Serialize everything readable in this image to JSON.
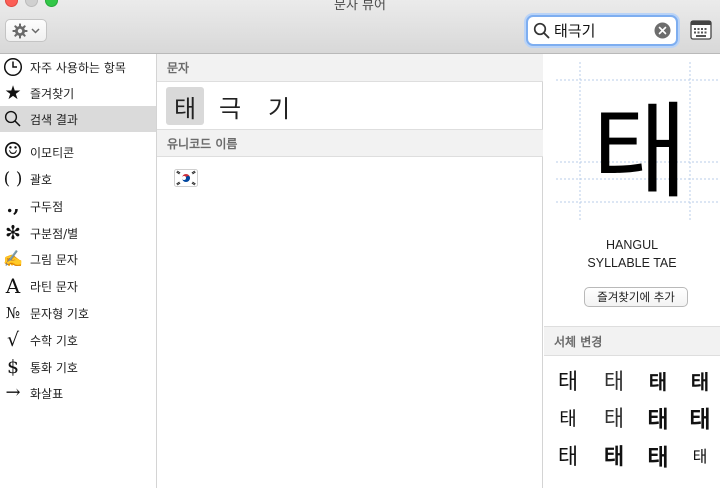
{
  "window": {
    "title": "문자 뷰어"
  },
  "toolbar": {
    "gear_icon": "gear-icon",
    "search": {
      "value": "태극기",
      "placeholder": ""
    },
    "keyboard_icon": "keyboard-viewer-icon"
  },
  "sidebar": {
    "items": [
      {
        "label": "자주 사용하는 항목",
        "icon": "clock-icon",
        "glyph": ""
      },
      {
        "label": "즐겨찾기",
        "icon": "star-icon",
        "glyph": "★"
      },
      {
        "label": "검색 결과",
        "icon": "magnifier-icon",
        "glyph": ""
      },
      {
        "label": "이모티콘",
        "icon": "smiley-icon",
        "glyph": "☺"
      },
      {
        "label": "괄호",
        "icon": "parentheses-icon",
        "glyph": "( )"
      },
      {
        "label": "구두점",
        "icon": "punctuation-icon",
        "glyph": ".,"
      },
      {
        "label": "구분점/별",
        "icon": "asterisk-icon",
        "glyph": "✻"
      },
      {
        "label": "그림 문자",
        "icon": "pencil-icon",
        "glyph": "✍"
      },
      {
        "label": "라틴 문자",
        "icon": "latin-icon",
        "glyph": "A"
      },
      {
        "label": "문자형 기호",
        "icon": "numero-icon",
        "glyph": "№"
      },
      {
        "label": "수학 기호",
        "icon": "sqrt-icon",
        "glyph": "√"
      },
      {
        "label": "통화 기호",
        "icon": "dollar-icon",
        "glyph": "$"
      },
      {
        "label": "화살표",
        "icon": "arrow-icon",
        "glyph": "→"
      }
    ],
    "selected_index": 2
  },
  "main": {
    "characters_header": "문자",
    "characters": [
      "태",
      "극",
      "기"
    ],
    "selected_character": 0,
    "unicode_names_header": "유니코드 이름",
    "unicode_results": [
      {
        "icon": "south-korea-flag-icon"
      }
    ]
  },
  "inspector": {
    "character": "태",
    "name": "HANGUL\nSYLLABLE TAE",
    "add_favorite_label": "즐겨찾기에 추가",
    "font_variation_header": "서체 변경",
    "variants": [
      "태",
      "태",
      "태",
      "태",
      "태",
      "태",
      "태",
      "태",
      "태",
      "태",
      "태",
      "태"
    ]
  }
}
